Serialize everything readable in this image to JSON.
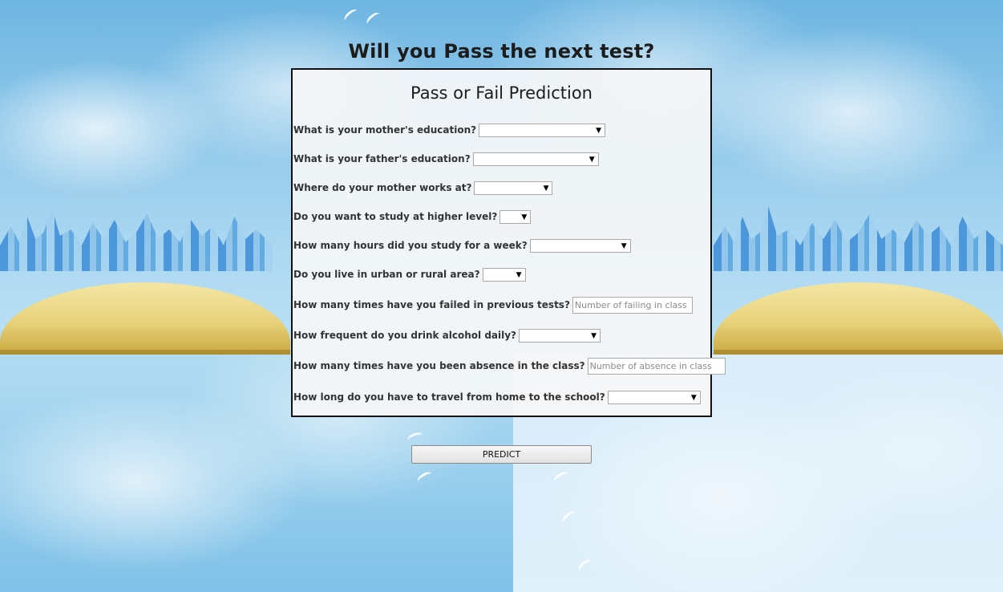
{
  "page": {
    "title": "Will you Pass the next test?"
  },
  "form": {
    "title": "Pass or Fail Prediction",
    "fields": [
      {
        "label": "What is your mother's education?",
        "type": "select",
        "value": ""
      },
      {
        "label": "What is your father's education?",
        "type": "select",
        "value": ""
      },
      {
        "label": "Where do your mother works at?",
        "type": "select",
        "value": ""
      },
      {
        "label": "Do you want to study at higher level?",
        "type": "select",
        "value": ""
      },
      {
        "label": "How many hours did you study for a week?",
        "type": "select",
        "value": ""
      },
      {
        "label": "Do you live in urban or rural area?",
        "type": "select",
        "value": ""
      },
      {
        "label": "How many times have you failed in previous tests?",
        "type": "text",
        "value": "",
        "placeholder": "Number of failing in class"
      },
      {
        "label": "How frequent do you drink alcohol daily?",
        "type": "select",
        "value": ""
      },
      {
        "label": "How many times have you been absence in the class?",
        "type": "text",
        "value": "",
        "placeholder": "Number of absence in class"
      },
      {
        "label": "How long do you have to travel from home to the school?",
        "type": "select",
        "value": ""
      }
    ]
  },
  "actions": {
    "predict_label": "PREDICT"
  },
  "icons": {
    "dropdown": "chevron-down-icon",
    "dropdown_glyph": "▼"
  }
}
